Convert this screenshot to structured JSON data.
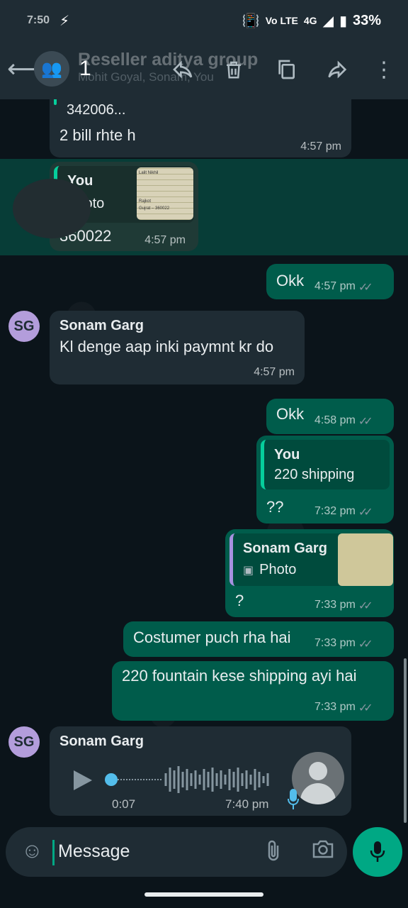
{
  "status_bar": {
    "time": "7:50",
    "network": "4G",
    "volte": "Vo LTE",
    "battery": "33%"
  },
  "header": {
    "selected_count": "1",
    "title": "Reseller aditya group",
    "subtitle": "Mohit Goyal, Sonam, You",
    "icons": [
      "back-arrow-icon",
      "group-avatar-icon",
      "reply-icon",
      "delete-icon",
      "copy-icon",
      "forward-icon",
      "more-icon"
    ]
  },
  "messages": {
    "m1": {
      "partial_text": "342006...",
      "text": "2 bill rhte h",
      "time": "4:57 pm"
    },
    "m2": {
      "quote_name": "You",
      "quote_text": "Photo",
      "text": "360022",
      "time": "4:57 pm",
      "thumb_lines": [
        "Lalit Nikhil",
        "",
        "",
        "",
        "Rajkot",
        "Gujrat – 360022"
      ]
    },
    "m3": {
      "text": "Okk",
      "time": "4:57 pm"
    },
    "m4": {
      "avatar": "SG",
      "sender": "Sonam Garg",
      "text": "Kl denge aap inki paymnt kr do",
      "time": "4:57 pm"
    },
    "m5": {
      "text": "Okk",
      "time": "4:58 pm"
    },
    "m6": {
      "quote_name": "You",
      "quote_text": "220 shipping",
      "text": "??",
      "time": "7:32 pm"
    },
    "m7": {
      "quote_name": "Sonam Garg",
      "quote_text": "Photo",
      "text": "?",
      "time": "7:33 pm"
    },
    "m8": {
      "text": "Costumer puch rha hai",
      "time": "7:33 pm"
    },
    "m9": {
      "text": "220 fountain kese shipping ayi hai",
      "time": "7:33 pm"
    },
    "m10": {
      "avatar": "SG",
      "sender": "Sonam Garg",
      "duration": "0:07",
      "time": "7:40 pm"
    }
  },
  "input": {
    "placeholder": "Message"
  },
  "colors": {
    "incoming": "#1f2c34",
    "outgoing": "#005c4b",
    "accent": "#00a884",
    "avatar": "#b39ddb"
  }
}
